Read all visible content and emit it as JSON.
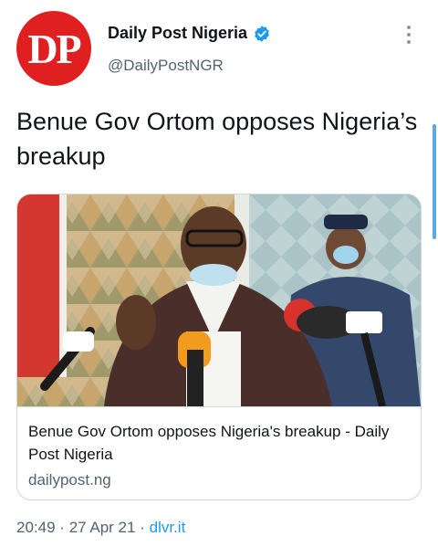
{
  "account": {
    "avatar_text": "DP",
    "display_name": "Daily Post Nigeria",
    "handle": "@DailyPostNGR",
    "verified_icon": "verified-badge-icon",
    "more_icon": "more-options-icon"
  },
  "tweet": {
    "text": "Benue Gov Ortom opposes Nigeria’s breakup"
  },
  "card": {
    "title": "Benue Gov Ortom opposes Nigeria's breakup - Daily Post Nigeria",
    "domain": "dailypost.ng",
    "image_alt": "news-photo"
  },
  "meta": {
    "time": "20:49",
    "date": "27 Apr 21",
    "separator": "·",
    "source": "dlvr.it"
  },
  "colors": {
    "avatar": "#e02020",
    "link": "#1d9bf0",
    "muted": "#536471",
    "verified": "#1d9bf0"
  }
}
